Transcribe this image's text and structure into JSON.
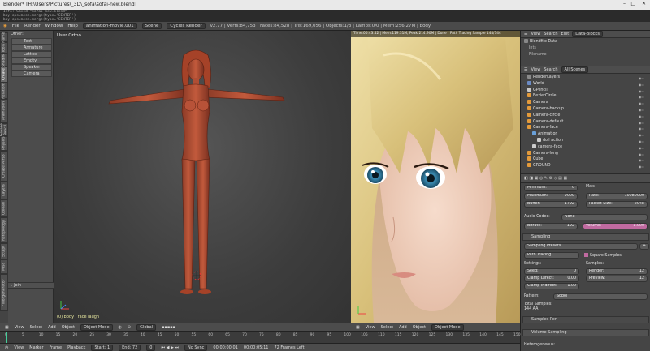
{
  "window": {
    "title": "Blender* [H:\\Users\\Pictures\\_3D\\_sofa\\sofai-new.blend]",
    "minimize": "–",
    "maximize": "□",
    "close": "✕"
  },
  "console_lines": [
    "Info: Saved \"sofai-new.blend\"",
    "bpy.ops.mesh.merge(type='CENTER')",
    "bpy.ops.mesh.merge(type='CENTER')"
  ],
  "infobar": {
    "menus": [
      "File",
      "Render",
      "Window",
      "Help"
    ],
    "screen": "animation-movie.001",
    "scene": "Scene",
    "engine": "Cycles Render",
    "stats": "v2.77 | Verts:84,753 | Faces:84,528 | Tris:169,056 | Objects:1/3 | Lamps:0/0 | Mem:256.27M | body"
  },
  "left_tabs": [
    "Fluorgenerator",
    "Misc",
    "Sculpt",
    "Retopology",
    "Upload",
    "Layers",
    "Create Pers3",
    "Physics",
    "Grease Pencil",
    "Animation",
    "Relations",
    "Create",
    "Shading",
    "Tools",
    "Name"
  ],
  "toolshelf": {
    "header": "Other:",
    "items": [
      "Text",
      "Armature",
      "Lattice",
      "Empty",
      "Speaker",
      "Camera"
    ],
    "join_panel": "Join"
  },
  "viewport3d": {
    "label": "User Ortho",
    "status": "(0) body : face laugh"
  },
  "render_view": {
    "info": "Time:00:43.42 | Mem:119.31M, Peak:214.90M | Done | Path Tracing Sample 144/144"
  },
  "header3d": {
    "items": [
      "View",
      "Select",
      "Add",
      "Object"
    ],
    "mode": "Object Mode",
    "orientation": "Global"
  },
  "header_render": {
    "items": [
      "View",
      "Select",
      "Add",
      "Object"
    ],
    "mode": "Object Mode"
  },
  "outliner": {
    "header": [
      "View",
      "Search",
      "Edit",
      "Data-Blocks"
    ],
    "top_rows": [
      "Blendfile Data",
      "Ints",
      "Filename"
    ],
    "view_tabs": [
      "View",
      "Search",
      "All Scenes"
    ],
    "rows": [
      {
        "name": "RenderLayers",
        "color": "#8a8a8a",
        "indent": 1
      },
      {
        "name": "World",
        "color": "#6a8ac4",
        "indent": 1
      },
      {
        "name": "GPencil",
        "color": "#c8c8c8",
        "indent": 1
      },
      {
        "name": "BezierCircle",
        "color": "#e39a3a",
        "indent": 1
      },
      {
        "name": "Camera",
        "color": "#e39a3a",
        "indent": 1
      },
      {
        "name": "Camera-backup",
        "color": "#e39a3a",
        "indent": 1
      },
      {
        "name": "Camera-circle",
        "color": "#e39a3a",
        "indent": 1
      },
      {
        "name": "Camera-default",
        "color": "#e39a3a",
        "indent": 1
      },
      {
        "name": "Camera-face",
        "color": "#e39a3a",
        "indent": 1
      },
      {
        "name": "Animation",
        "color": "#6aa0d8",
        "indent": 2
      },
      {
        "name": "doll action",
        "color": "#cccccc",
        "indent": 3
      },
      {
        "name": "camera-face",
        "color": "#cccccc",
        "indent": 2
      },
      {
        "name": "Camera-long",
        "color": "#e39a3a",
        "indent": 1
      },
      {
        "name": "Cube",
        "color": "#e39a3a",
        "indent": 1
      },
      {
        "name": "GROUND",
        "color": "#e39a3a",
        "indent": 1
      }
    ]
  },
  "properties": {
    "encoding": {
      "minimum_label": "Minimum:",
      "minimum": "0",
      "maximum_label": "Maximum:",
      "maximum": "9000",
      "buffer_label": "Buffer:",
      "buffer": "1792",
      "max_label": "Max:",
      "rate_label": "Rate:",
      "rate": "10080000",
      "packet_label": "Packet Size:",
      "packet": "2048",
      "audio_codec_label": "Audio Codec:",
      "audio_codec": "None",
      "bitrate_label": "Bitrate:",
      "bitrate": "192",
      "volume_label": "Volume:",
      "volume": "1.000"
    },
    "sampling": {
      "title": "Sampling",
      "presets": "Sampling Presets",
      "integrator": "Path Tracing",
      "square_samples": "Square Samples",
      "settings_label": "Settings:",
      "samples_label": "Samples:",
      "seed_label": "Seed:",
      "seed": "0",
      "clamp_direct_label": "Clamp Direct:",
      "clamp_direct": "0.00",
      "clamp_indirect_label": "Clamp Indirect:",
      "clamp_indirect": "1.00",
      "render_label": "Render:",
      "render": "12",
      "preview_label": "Preview:",
      "preview": "12",
      "pattern_label": "Pattern:",
      "pattern": "Sobol",
      "total_label": "Total Samples:",
      "total": "144 AA",
      "samples_per": "Samples Per:"
    },
    "volume_sampling": {
      "title": "Volume Sampling",
      "heterogeneous": "Heterogeneous:"
    }
  },
  "timeline": {
    "ticks": [
      "0",
      "5",
      "10",
      "15",
      "20",
      "25",
      "30",
      "35",
      "40",
      "45",
      "50",
      "55",
      "60",
      "65",
      "70",
      "75",
      "80",
      "85",
      "90",
      "95",
      "100",
      "105",
      "110",
      "115",
      "120",
      "125",
      "130",
      "135",
      "140",
      "145",
      "150"
    ],
    "current": "0"
  },
  "timeline_header": {
    "items": [
      "View",
      "Marker",
      "Frame",
      "Playback"
    ],
    "start_label": "Start:",
    "start": "1",
    "end_label": "End:",
    "end": "72",
    "current": "0",
    "sync": "No Sync",
    "time_a": "00:00:00:01",
    "time_b": "00:00:05:11",
    "frames_left": "72 Frames Left"
  }
}
